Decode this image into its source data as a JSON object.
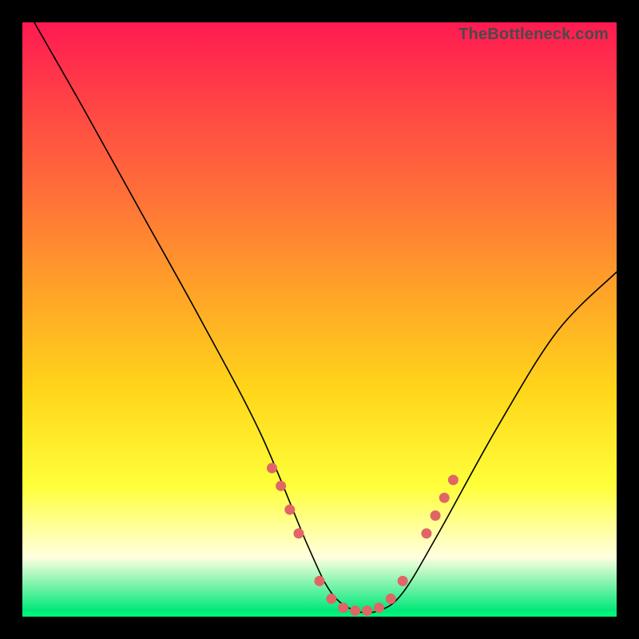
{
  "watermark": "TheBottleneck.com",
  "chart_data": {
    "type": "line",
    "title": "",
    "xlabel": "",
    "ylabel": "",
    "xlim": [
      0,
      100
    ],
    "ylim": [
      0,
      100
    ],
    "series": [
      {
        "name": "curve",
        "x": [
          2,
          10,
          20,
          30,
          40,
          48,
          52,
          56,
          60,
          64,
          70,
          80,
          90,
          100
        ],
        "y": [
          100,
          86,
          68,
          50,
          31,
          12,
          4,
          1,
          1,
          4,
          14,
          32,
          48,
          58
        ]
      }
    ],
    "markers": {
      "name": "highlight-dots",
      "color": "#e06666",
      "x": [
        42,
        43.5,
        45,
        46.5,
        50,
        52,
        54,
        56,
        58,
        60,
        62,
        64,
        68,
        69.5,
        71,
        72.5
      ],
      "y": [
        25,
        22,
        18,
        14,
        6,
        3,
        1.5,
        1,
        1,
        1.5,
        3,
        6,
        14,
        17,
        20,
        23
      ]
    }
  }
}
